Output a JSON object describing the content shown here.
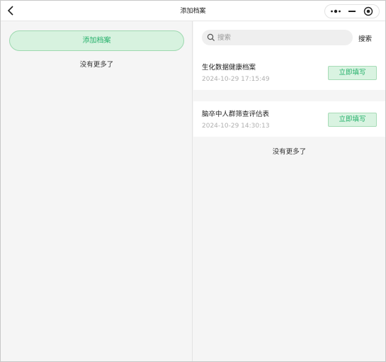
{
  "titlebar": {
    "title": "添加档案",
    "back_icon": "chevron-left-icon",
    "more_icon": "more-dots-icon",
    "minimize_icon": "minimize-icon",
    "close_icon": "record-circle-icon"
  },
  "left": {
    "add_button_label": "添加档案",
    "no_more_text": "没有更多了"
  },
  "search": {
    "placeholder": "搜索",
    "value": "",
    "button_label": "搜索"
  },
  "records": [
    {
      "name": "生化数据健康档案",
      "time": "2024-10-29 17:15:49",
      "action_label": "立即填写"
    },
    {
      "name": "脑卒中人群筛查评估表",
      "time": "2024-10-29 14:30:13",
      "action_label": "立即填写"
    }
  ],
  "right": {
    "no_more_text": "没有更多了"
  },
  "colors": {
    "accent": "#24b06a",
    "accent_bg": "#d7f2df",
    "background": "#f5f5f5"
  }
}
